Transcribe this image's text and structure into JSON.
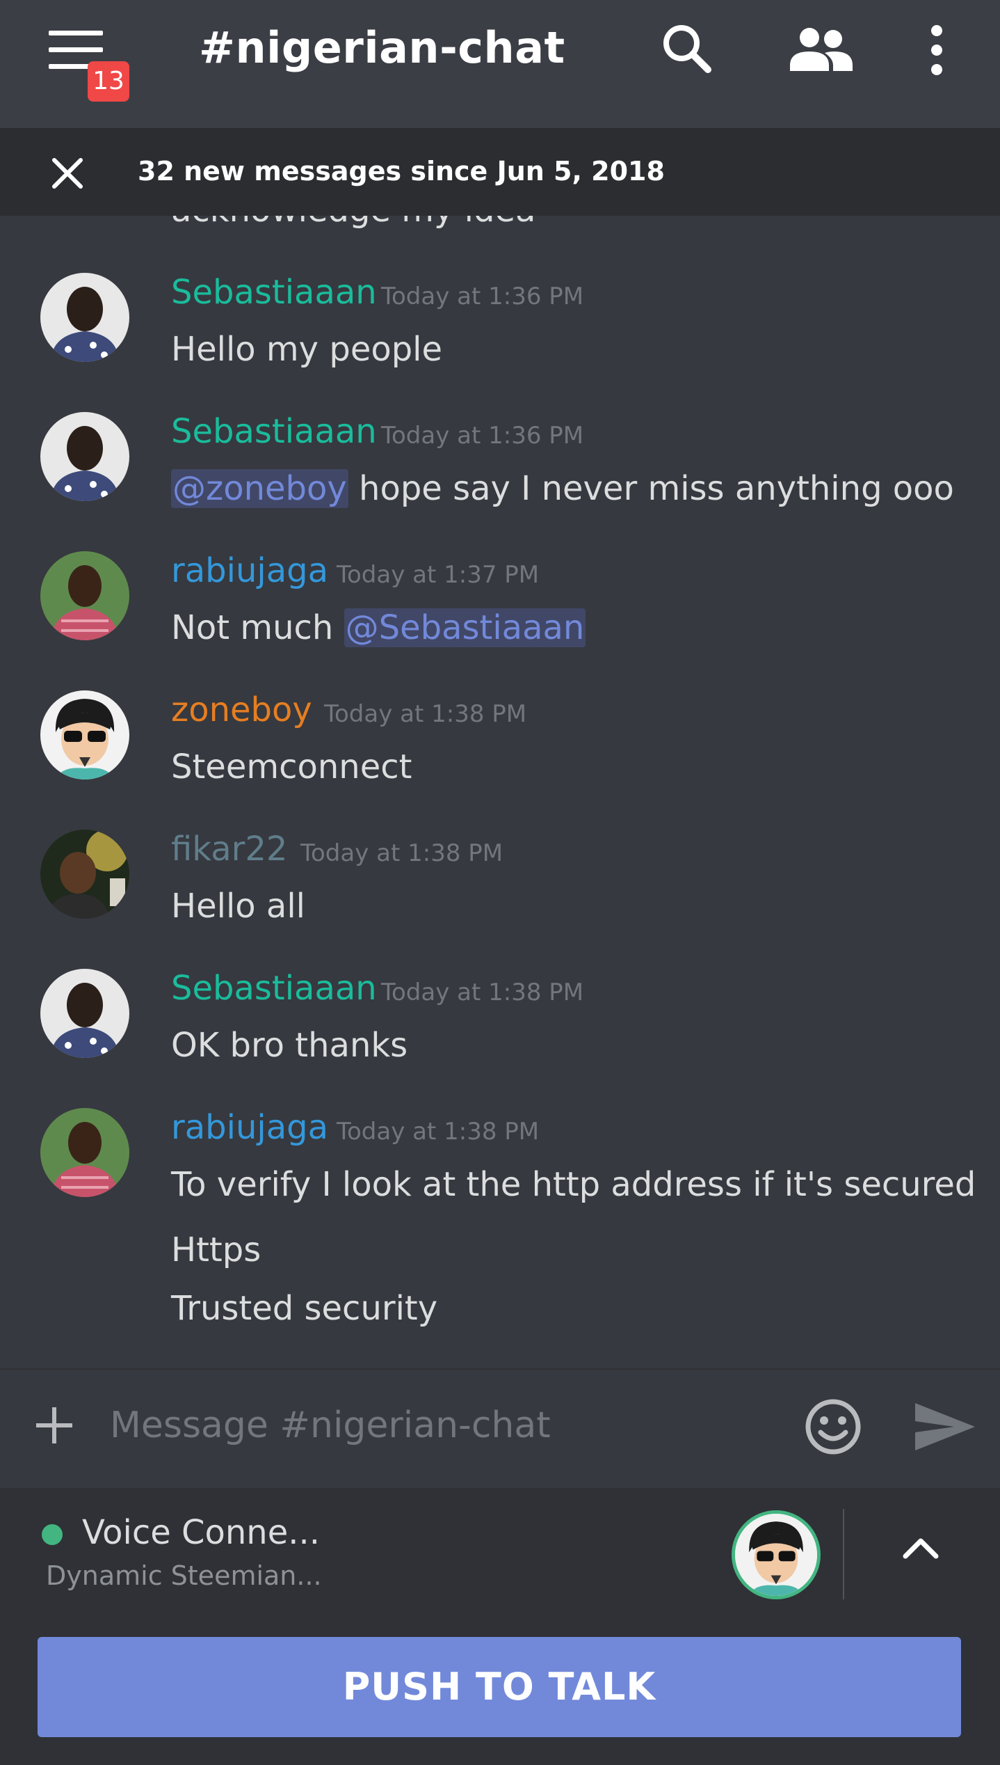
{
  "header": {
    "channel_name": "#nigerian-chat",
    "notification_count": "13",
    "icons": [
      "menu-icon",
      "search-icon",
      "members-icon",
      "more-icon"
    ]
  },
  "new_messages_bar": {
    "text": "32 new messages since Jun 5, 2018"
  },
  "chat": {
    "cut_off_text": "acknowledge my idea",
    "messages": [
      {
        "author": "Sebastiaaan",
        "author_color": "#1abc9c",
        "timestamp": "Today at 1:36 PM",
        "lines": [
          "Hello my people"
        ]
      },
      {
        "author": "Sebastiaaan",
        "author_color": "#1abc9c",
        "timestamp": "Today at 1:36 PM",
        "mention": "@zoneboy",
        "text_after": " hope say I never miss anything ooo"
      },
      {
        "author": "rabiujaga",
        "author_color": "#3498db",
        "timestamp": "Today at 1:37 PM",
        "text_before": "Not much ",
        "mention": "@Sebastiaaan"
      },
      {
        "author": "zoneboy",
        "author_color": "#e67e22",
        "timestamp": "Today at 1:38 PM",
        "lines": [
          "Steemconnect"
        ]
      },
      {
        "author": "fikar22",
        "author_color": "#607d8b",
        "timestamp": "Today at 1:38 PM",
        "lines": [
          "Hello all"
        ]
      },
      {
        "author": "Sebastiaaan",
        "author_color": "#1abc9c",
        "timestamp": "Today at 1:38 PM",
        "lines": [
          "OK bro thanks"
        ]
      },
      {
        "author": "rabiujaga",
        "author_color": "#3498db",
        "timestamp": "Today at 1:38 PM",
        "lines": [
          "To verify I look at the http address if it's secured",
          "Https",
          "Trusted security"
        ]
      }
    ]
  },
  "composer": {
    "placeholder": "Message #nigerian-chat"
  },
  "voice": {
    "status": "Voice Conne...",
    "channel": "Dynamic Steemian...",
    "status_color": "#43b581"
  },
  "push_to_talk": {
    "label": "PUSH TO TALK",
    "color": "#7289da"
  }
}
